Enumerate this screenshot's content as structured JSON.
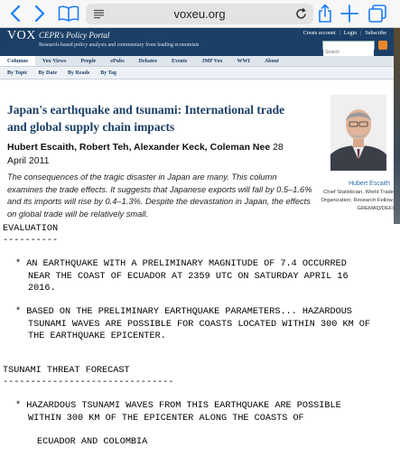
{
  "browser": {
    "url": "voxeu.org",
    "icons": {
      "back": "chevron-left-icon",
      "forward": "chevron-right-icon",
      "bookmarks": "book-icon",
      "reader": "reader-menu-icon",
      "reload": "reload-icon",
      "share": "share-icon",
      "new_tab": "plus-icon",
      "tabs": "tabs-icon"
    },
    "accent": "#1a7cf5"
  },
  "site": {
    "logo": "VOX",
    "portal_name": "CEPR's Policy Portal",
    "tagline": "Research-based policy analysis and commentary from leading economists",
    "header_links": [
      "Create account",
      "Login",
      "Subscribe"
    ],
    "search_placeholder": "Search",
    "brand_color": "#1b3f66",
    "nav": [
      "Columns",
      "Vox Views",
      "People",
      "ePubs",
      "Debates",
      "Events",
      "JMP Vox",
      "WWI",
      "About"
    ],
    "subnav": [
      "By Topic",
      "By Date",
      "By Reads",
      "By Tag"
    ]
  },
  "article": {
    "title": "Japan's earthquake and tsunami: International trade and global supply chain impacts",
    "authors": "Hubert Escaith, Robert Teh, Alexander Keck, Coleman Nee",
    "date": "28 April 2011",
    "summary": "The consequences of the tragic disaster in Japan are many. This column examines the trade effects. It suggests that Japanese exports will fall by 0.5–1.6% and its imports will rise by 0.4–1.3%. Despite the devastation in Japan, the effects on global trade will be relatively small.",
    "photo_caption": {
      "name": "Hubert Escaith",
      "role": "Chief Statistician, World Trade Organization; Research Fellow, GREMAQ/DEFI"
    }
  },
  "bulletin": {
    "heading1": "EVALUATION",
    "rule1": "----------",
    "bullet1_line1": "* AN EARTHQUAKE WITH A PRELIMINARY MAGNITUDE OF 7.4 OCCURRED",
    "bullet1_line2": "NEAR THE COAST OF ECUADOR AT 2359 UTC ON SATURDAY APRIL 16",
    "bullet1_line3": "2016.",
    "bullet2_line1": "* BASED ON THE PRELIMINARY EARTHQUAKE PARAMETERS... HAZARDOUS",
    "bullet2_line2": "TSUNAMI WAVES ARE POSSIBLE FOR COASTS LOCATED WITHIN 300 KM OF",
    "bullet2_line3": "THE EARTHQUAKE EPICENTER.",
    "heading2": "TSUNAMI THREAT FORECAST",
    "rule2": "-------------------------------",
    "bullet3_line1": "* HAZARDOUS TSUNAMI WAVES FROM THIS EARTHQUAKE ARE POSSIBLE",
    "bullet3_line2": "WITHIN 300 KM OF THE EPICENTER ALONG THE COASTS OF",
    "location": "ECUADOR AND COLOMBIA"
  }
}
